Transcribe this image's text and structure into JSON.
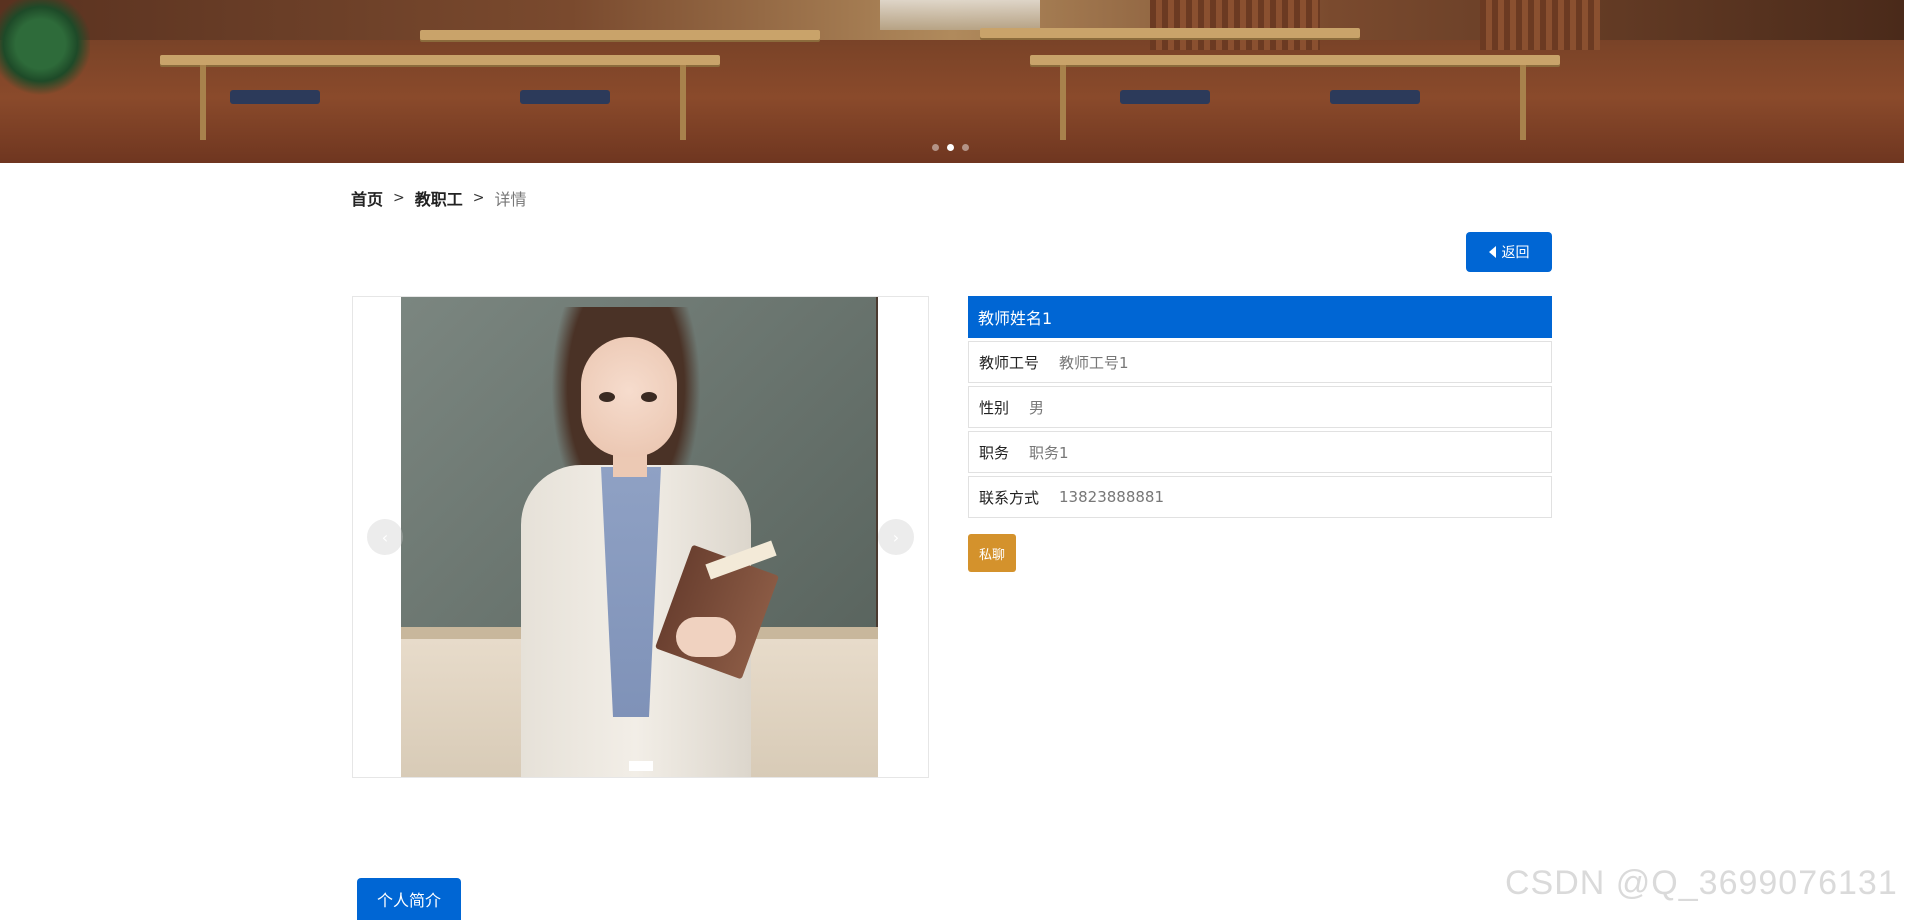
{
  "banner": {
    "slide_count": 3,
    "active_slide": 2
  },
  "breadcrumb": {
    "home": "首页",
    "section": "教职工",
    "current": "详情",
    "separator": ">"
  },
  "back_button": {
    "label": "返回",
    "icon": "caret-left-icon"
  },
  "gallery": {
    "prev_icon": "chevron-left-icon",
    "next_icon": "chevron-right-icon",
    "prev_label": "‹",
    "next_label": "›"
  },
  "teacher": {
    "name": "教师姓名1",
    "fields": [
      {
        "label": "教师工号",
        "value": "教师工号1"
      },
      {
        "label": "性别",
        "value": "男"
      },
      {
        "label": "职务",
        "value": "职务1"
      },
      {
        "label": "联系方式",
        "value": "13823888881"
      }
    ]
  },
  "chat_button": {
    "label": "私聊"
  },
  "tabs": {
    "intro": "个人简介"
  },
  "watermark": "CSDN @Q_3699076131",
  "colors": {
    "primary": "#0066d4",
    "chat": "#d4922c"
  }
}
